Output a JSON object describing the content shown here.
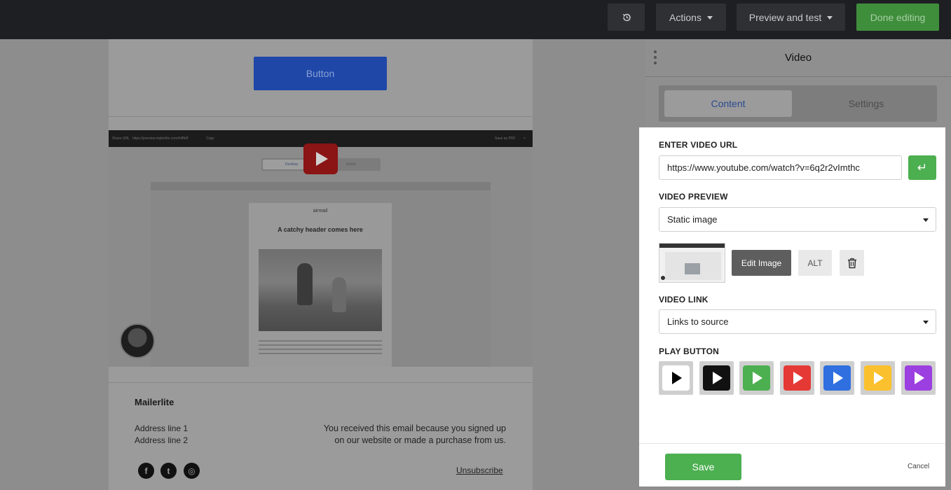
{
  "topbar": {
    "history_icon": "history-icon",
    "actions_label": "Actions",
    "preview_label": "Preview and test",
    "done_label": "Done editing"
  },
  "email": {
    "button_label": "Button",
    "video_preview": {
      "share_label": "Share URL",
      "share_url": "https://preview.mailerlite.com/h4fb0f",
      "copy_label": "Copy",
      "pdf_label": "Save as PDF",
      "close_label": "×",
      "tab_desktop": "Desktop",
      "tab_mobile": "Mobile",
      "brand": "airmail",
      "header": "A catchy header comes here"
    },
    "footer": {
      "brand": "Mailerlite",
      "address_line1": "Address line 1",
      "address_line2": "Address line 2",
      "note": "You received this email because you signed up on our website or made a purchase from us.",
      "unsubscribe": "Unsubscribe",
      "social": [
        {
          "icon": "facebook-icon",
          "glyph": "f"
        },
        {
          "icon": "twitter-icon",
          "glyph": "t"
        },
        {
          "icon": "instagram-icon",
          "glyph": "◎"
        }
      ]
    }
  },
  "panel": {
    "title": "Video",
    "tabs": [
      "Content",
      "Settings"
    ],
    "video_url_label": "ENTER VIDEO URL",
    "video_url_value": "https://www.youtube.com/watch?v=6q2r2vImthc",
    "enter_glyph": "↵",
    "video_preview_label": "VIDEO PREVIEW",
    "video_preview_value": "Static image",
    "edit_image_label": "Edit Image",
    "alt_label": "ALT",
    "video_link_label": "VIDEO LINK",
    "video_link_value": "Links to source",
    "play_button_label": "PLAY BUTTON",
    "play_buttons": [
      {
        "name": "white",
        "bg": "#ffffff",
        "fg": "#000000"
      },
      {
        "name": "black",
        "bg": "#111111",
        "fg": "#ffffff"
      },
      {
        "name": "green",
        "bg": "#4caf50",
        "fg": "#ffffff"
      },
      {
        "name": "red",
        "bg": "#e53935",
        "fg": "#ffffff"
      },
      {
        "name": "blue",
        "bg": "#2f6fe0",
        "fg": "#ffffff"
      },
      {
        "name": "yellow",
        "bg": "#fbc02d",
        "fg": "#ffffff"
      },
      {
        "name": "purple",
        "bg": "#9c3fe0",
        "fg": "#ffffff"
      }
    ],
    "save_label": "Save",
    "cancel_label": "Cancel"
  },
  "colors": {
    "accent_green": "#4caf50",
    "topbar_bg": "#1d1f22",
    "email_button_blue": "#1e47a8"
  }
}
